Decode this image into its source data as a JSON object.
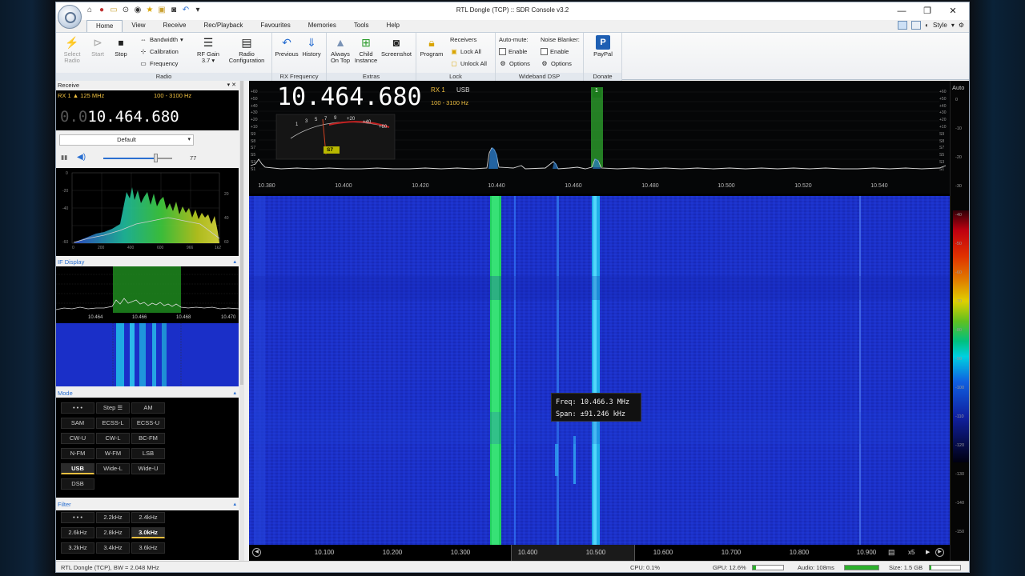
{
  "window": {
    "title": "RTL Dongle (TCP) :: SDR Console v3.2",
    "buttons": [
      "minimize",
      "maximize",
      "close"
    ]
  },
  "quick_access_icons": [
    "home-icon",
    "record-icon",
    "folder-icon",
    "play-icon",
    "stop-icon",
    "star-icon",
    "lock-icon",
    "camera-icon",
    "undo-icon",
    "dropdown-icon"
  ],
  "tabs": [
    "Home",
    "View",
    "Receive",
    "Rec/Playback",
    "Favourites",
    "Memories",
    "Tools",
    "Help"
  ],
  "style_label": "Style",
  "ribbon": {
    "radio": {
      "label": "Radio",
      "select_radio": "Select Radio",
      "start": "Start",
      "stop": "Stop",
      "bandwidth": "Bandwidth",
      "calibration": "Calibration",
      "frequency": "Frequency",
      "rf_gain": "RF Gain",
      "rf_gain_value": "3.7",
      "radio_configuration": "Radio Configuration"
    },
    "rx_frequency": {
      "label": "RX Frequency",
      "previous": "Previous",
      "history": "History"
    },
    "extras": {
      "label": "Extras",
      "always_on_top": "Always On Top",
      "child_instance": "Child Instance",
      "screenshot": "Screenshot"
    },
    "lock": {
      "label": "Lock",
      "program": "Program",
      "receivers": "Receivers",
      "lock_all": "Lock All",
      "unlock_all": "Unlock All"
    },
    "wideband_dsp": {
      "label": "Wideband DSP",
      "auto_mute": "Auto-mute:",
      "auto_enable": "Enable",
      "auto_options": "Options",
      "noise_blanker": "Noise Blanker:",
      "nb_enable": "Enable",
      "nb_options": "Options"
    },
    "donate": {
      "label": "Donate",
      "paypal": "PayPal"
    }
  },
  "left": {
    "receive_title": "Receive",
    "rx_info": "RX 1",
    "rx_range": "125 MHz",
    "rx_bw": "100 - 3100 Hz",
    "rx_freq_dim": "0.0",
    "rx_freq": "10.464.680",
    "profile": "Default",
    "volume": 77,
    "volume_label": "77",
    "audio_spectrum": {
      "xticks": [
        "0",
        "200",
        "400",
        "600",
        "966",
        "1k2"
      ],
      "yticks_left": [
        "0",
        "-20",
        "-40",
        "-60"
      ],
      "yticks_right": [
        "20",
        "40",
        "60"
      ]
    },
    "if_title": "IF Display",
    "if_ticks": [
      "10.464",
      "10.466",
      "10.468",
      "10.470"
    ],
    "mode_title": "Mode",
    "modes": [
      "• • •",
      "Step ☰",
      "AM",
      "SAM",
      "ECSS-L",
      "ECSS-U",
      "CW-U",
      "CW-L",
      "BC-FM",
      "N-FM",
      "W-FM",
      "LSB",
      "USB",
      "Wide-L",
      "Wide-U",
      "DSB"
    ],
    "mode_selected": "USB",
    "filter_title": "Filter",
    "filters": [
      "• • •",
      "2.2kHz",
      "2.4kHz",
      "2.6kHz",
      "2.8kHz",
      "3.0kHz",
      "3.2kHz",
      "3.4kHz",
      "3.6kHz"
    ],
    "filter_selected": "3.0kHz"
  },
  "main": {
    "big_freq": "10.464.680",
    "rx_label": "RX 1",
    "mode": "USB",
    "bandwidth": "100 - 3100 Hz",
    "smeter": {
      "scale": [
        "1",
        "3",
        "5",
        "7",
        "9",
        "+20",
        "+40",
        "+60"
      ],
      "reading": "S7"
    },
    "marker": "1",
    "spectrum_left_scale": [
      "+60",
      "+50",
      "+40",
      "+30",
      "+20",
      "+10",
      "S9",
      "S8",
      "S7",
      "S5",
      "S3",
      "S1"
    ],
    "spectrum_axis": [
      "10.380",
      "10.400",
      "10.420",
      "10.440",
      "10.460",
      "10.480",
      "10.500",
      "10.520",
      "10.540"
    ],
    "right_scale_top": "Auto",
    "right_scale_labels": [
      "0",
      "-10",
      "-20",
      "-30",
      "-40",
      "-50",
      "-60",
      "-70",
      "-80",
      "-90",
      "-100",
      "-110",
      "-120",
      "-130",
      "-140",
      "-150"
    ],
    "tooltip_freq": "Freq: 10.466.3 MHz",
    "tooltip_span": "Span:  ±91.246 kHz",
    "bottom_axis": [
      "10.100",
      "10.200",
      "10.300",
      "10.400",
      "10.500",
      "10.600",
      "10.700",
      "10.800",
      "10.900"
    ],
    "zoom": "x5"
  },
  "status": {
    "device": "RTL Dongle (TCP), BW = 2.048 MHz",
    "cpu": "CPU: 0.1%",
    "gpu": "GPU: 12.6%",
    "gpu_level": 0.1,
    "audio": "Audio: 108ms",
    "audio_level": 1.0,
    "size": "Size: 1.5 GB"
  }
}
